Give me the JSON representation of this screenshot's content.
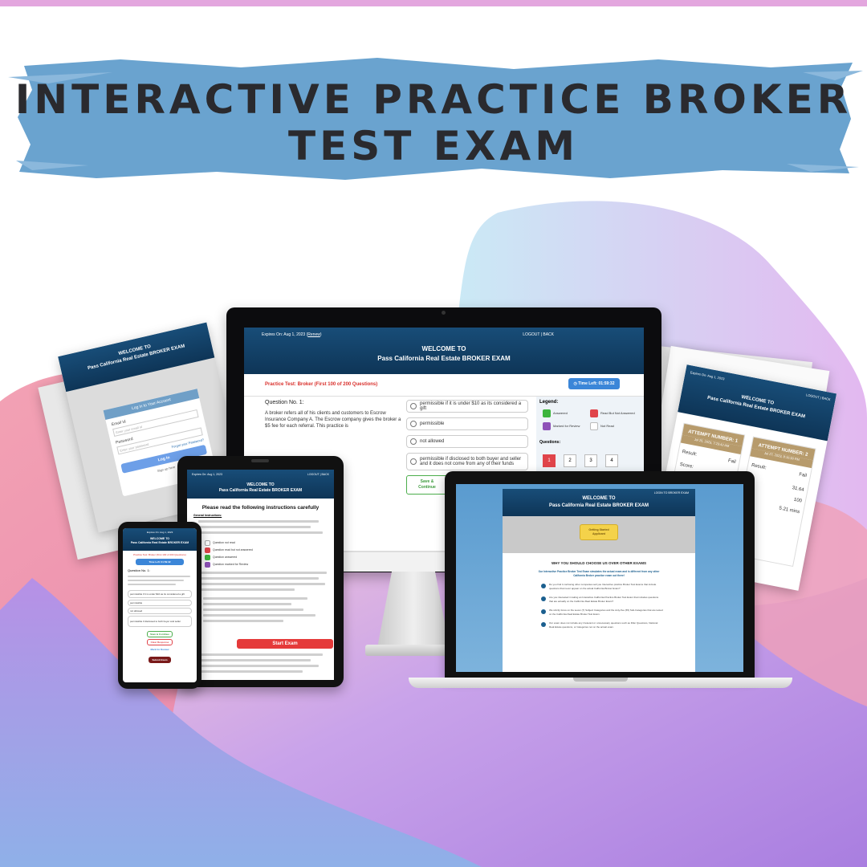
{
  "colors": {
    "top_stripe": "#e3a6de",
    "banner": "#6aa3cf",
    "navy": "#123f66",
    "red": "#d9302c",
    "gold": "#b79b6c",
    "yellow": "#f4d24a"
  },
  "headline": {
    "line1": "INTERACTIVE PRACTICE BROKER",
    "line2": "TEST EXAM"
  },
  "monitor": {
    "expires": "Expires On: Aug 1, 2023",
    "renew": "Renew",
    "nav": "LOGOUT | BACK",
    "welcome": "WELCOME TO",
    "title": "Pass California Real Estate BROKER EXAM",
    "practice": "Practice Test: Broker (First 100 of 200 Questions)",
    "timer": "Time Left: 01:59:32",
    "question_no": "Question No. 1:",
    "question": "A broker refers all of his clients and customers to Escrow Insurance Company A. The Escrow company gives the broker a $5 fee for each referral. This practice is",
    "options": [
      "permissible if it is under $10 as its considered a gift",
      "permissible",
      "not allowed",
      "permissible if disclosed to both buyer and seller and it does not come from any of their funds"
    ],
    "save_button": "Save & Continue",
    "legend_title": "Legend:",
    "legend": [
      "Answered",
      "Read But Not Answered",
      "Marked for Review",
      "Not Read"
    ],
    "questions_title": "Questions:",
    "question_numbers": [
      "1",
      "2",
      "3",
      "4"
    ]
  },
  "back_tablet": {
    "welcome": "WELCOME TO",
    "title": "Pass California Real Estate BROKER EXAM",
    "login_title": "Log in to Your Account",
    "email_label": "Email Id",
    "email_ph": "Enter your email id",
    "password_label": "Password",
    "password_ph": "Enter your password",
    "forgot": "Forgot your Password?",
    "login_button": "Log In",
    "signup": "Sign up here"
  },
  "tablet": {
    "expires": "Expires On: Aug 1, 2023",
    "nav": "LOGOUT | BACK",
    "welcome": "WELCOME TO",
    "title": "Pass California Real Estate BROKER EXAM",
    "instructions_title": "Please read the following instructions carefully",
    "general": "General Instructions:",
    "legend": [
      "Question not read",
      "Question read but not answered",
      "Question answered",
      "Question marked for Review"
    ],
    "start_button": "Start Exam"
  },
  "phone": {
    "expires": "Expires On: Aug 1, 2023",
    "welcome": "WELCOME TO",
    "title": "Pass California Real Estate BROKER EXAM",
    "practice": "Practice Test: Broker (First 100 of 200 Questions)",
    "timer": "Time Left: 01:59:32",
    "question_no": "Question No. 1:",
    "options": [
      "permissible if it is under $10 as its considered a gift",
      "permissible",
      "not allowed",
      "permissible if disclosed to both buyer and seller"
    ],
    "buttons": [
      "Save & Continue",
      "Clear Response",
      "Mark for Review"
    ],
    "submit": "Submit Exam"
  },
  "laptop": {
    "nav": "LOGIN TO BROKER EXAM",
    "welcome": "WELCOME TO",
    "title": "Pass California Real Estate BROKER EXAM",
    "cta_line1": "Getting Started",
    "cta_line2": "Applicant",
    "why": "WHY YOU SHOULD CHOOSE US OVER OTHER EXAMS",
    "intro": "Our Interactive Practice Broker Test Exam simulates the actual exam and is different from any other California Broker practice exam out there!",
    "points": [
      "Do you find it confusing other companies sell you Interactive practice Broker Test Exams that include questions that never appear on the actual California Broker Exam?",
      "Are you interested in taking an Interactive California Practice Broker Test Exam that includes questions that are actually on the California Real Estate Broker Exam?",
      "We strictly focus on the seven (7) Subject Categories and the sixty-five (65) Sub-Categories that are tested on the California Real Estate Broker Test Exam.",
      "Our exam does not include any irrelevant or unnecessary questions such as Filler Questions, National Real Estate questions, or Categories not on the actual exam."
    ]
  },
  "results": {
    "expires": "Expires On: Aug 1, 2023",
    "renew": "Renew",
    "nav": "LOGOUT | BACK",
    "welcome": "WELCOME TO",
    "title": "Pass California Real Estate BROKER EXAM",
    "attempt1": "ATTEMPT NUMBER: 1",
    "date1": "Jul 25, 2023, 7:23:42 AM",
    "attempt2": "ATTEMPT NUMBER: 2",
    "date2": "Jul 27, 2023, 8:10:30 PM",
    "result_label": "Result:",
    "score_label": "Score:",
    "result_value": "Fail",
    "score_value": "31.64",
    "marks": "100",
    "time": "5.21 mins",
    "detail": "Result"
  }
}
